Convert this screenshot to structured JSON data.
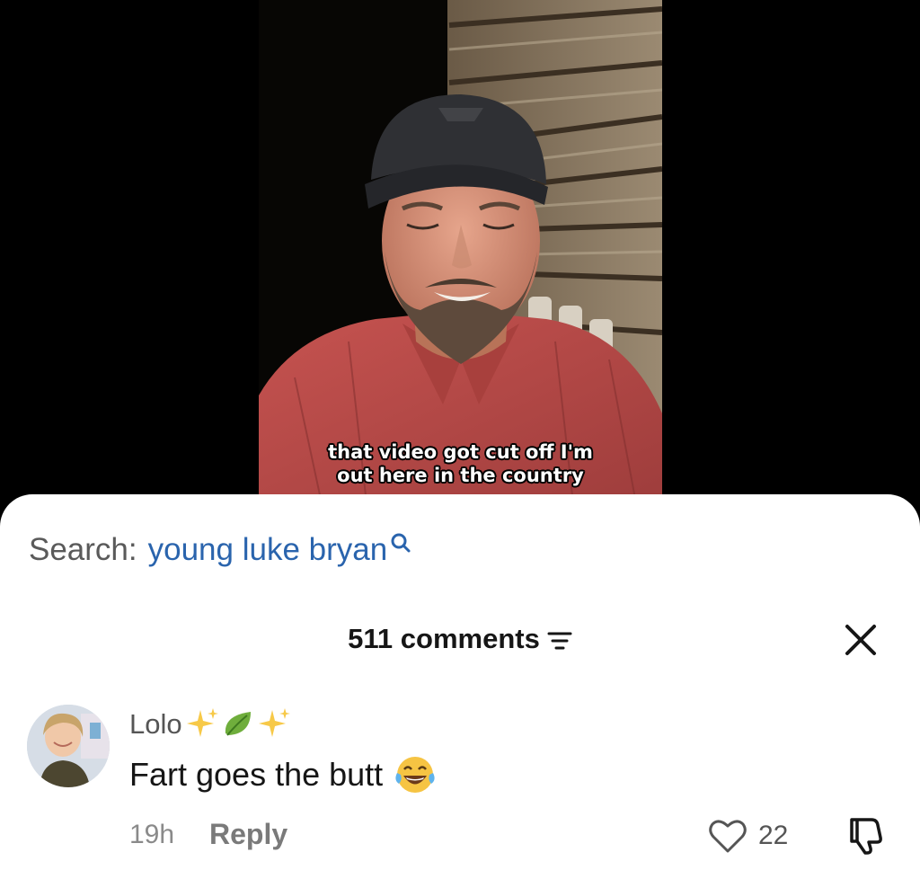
{
  "video": {
    "caption_line1": "that video got cut off I'm",
    "caption_line2": "out here in the country"
  },
  "search": {
    "prefix": "Search:",
    "query": "young luke bryan",
    "icon": "search-icon",
    "query_color": "#2a64ad"
  },
  "comments_header": {
    "title": "511 comments",
    "sort_icon": "sort-icon",
    "close_icon": "close-icon"
  },
  "comment": {
    "username": "Lolo",
    "username_emoji": [
      "sparkles",
      "leaf",
      "sparkles"
    ],
    "text": "Fart goes the butt",
    "text_emoji": "face-with-tears-of-joy",
    "timestamp": "19h",
    "reply_label": "Reply",
    "like_count": "22",
    "like_icon": "heart-icon",
    "dislike_icon": "thumbs-down-icon"
  }
}
